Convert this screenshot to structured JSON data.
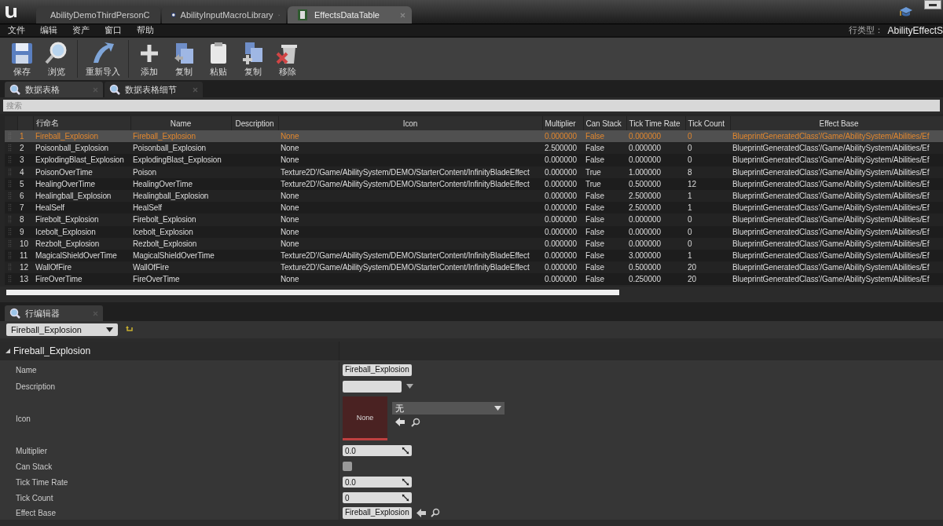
{
  "window": {
    "tabs": [
      {
        "label": "AbilityDemoThirdPersonC",
        "kind": "blueprint",
        "selected": false
      },
      {
        "label": "AbilityInputMacroLibrary",
        "kind": "macro",
        "selected": false
      },
      {
        "label": "EffectsDataTable",
        "kind": "datatable",
        "selected": true
      }
    ]
  },
  "menu": [
    "文件",
    "编辑",
    "资产",
    "窗口",
    "帮助"
  ],
  "row_type": {
    "label": "行类型：",
    "value": "AbilityEffectS"
  },
  "toolbar": [
    {
      "label": "保存",
      "kind": "save"
    },
    {
      "label": "浏览",
      "kind": "browse"
    },
    {
      "label": "重新导入",
      "kind": "reimport"
    },
    {
      "label": "添加",
      "kind": "add"
    },
    {
      "label": "复制",
      "kind": "copy"
    },
    {
      "label": "粘贴",
      "kind": "paste"
    },
    {
      "label": "复制",
      "kind": "duplicate"
    },
    {
      "label": "移除",
      "kind": "remove"
    }
  ],
  "panel_tabs": [
    {
      "label": "数据表格",
      "selected": true
    },
    {
      "label": "数据表格细节",
      "selected": false
    }
  ],
  "search": {
    "placeholder": "搜索"
  },
  "table": {
    "columns": [
      "",
      "行命名",
      "Name",
      "Description",
      "Icon",
      "Multiplier",
      "Can Stack",
      "Tick Time Rate",
      "Tick Count",
      "Effect Base"
    ],
    "rows": [
      {
        "selected": true,
        "cells": [
          "1",
          "Fireball_Explosion",
          "Fireball_Explosion",
          "",
          "None",
          "0.000000",
          "False",
          "0.000000",
          "0",
          "BlueprintGeneratedClass'/Game/AbilitySystem/Abilities/Ef"
        ]
      },
      {
        "selected": false,
        "cells": [
          "2",
          "Poisonball_Explosion",
          "Poisonball_Explosion",
          "",
          "None",
          "2.500000",
          "False",
          "0.000000",
          "0",
          "BlueprintGeneratedClass'/Game/AbilitySystem/Abilities/Ef"
        ]
      },
      {
        "selected": false,
        "cells": [
          "3",
          "ExplodingBlast_Explosion",
          "ExplodingBlast_Explosion",
          "",
          "None",
          "0.000000",
          "False",
          "0.000000",
          "0",
          "BlueprintGeneratedClass'/Game/AbilitySystem/Abilities/Ef"
        ]
      },
      {
        "selected": false,
        "cells": [
          "4",
          "PoisonOverTime",
          "Poison",
          "",
          "Texture2D'/Game/AbilitySystem/DEMO/StarterContent/InfinityBladeEffect",
          "0.000000",
          "True",
          "1.000000",
          "8",
          "BlueprintGeneratedClass'/Game/AbilitySystem/Abilities/Ef"
        ]
      },
      {
        "selected": false,
        "cells": [
          "5",
          "HealingOverTime",
          "HealingOverTime",
          "",
          "Texture2D'/Game/AbilitySystem/DEMO/StarterContent/InfinityBladeEffect",
          "0.000000",
          "True",
          "0.500000",
          "12",
          "BlueprintGeneratedClass'/Game/AbilitySystem/Abilities/Ef"
        ]
      },
      {
        "selected": false,
        "cells": [
          "6",
          "Healingball_Explosion",
          "Healingball_Explosion",
          "",
          "None",
          "0.000000",
          "False",
          "2.500000",
          "1",
          "BlueprintGeneratedClass'/Game/AbilitySystem/Abilities/Ef"
        ]
      },
      {
        "selected": false,
        "cells": [
          "7",
          "HealSelf",
          "HealSelf",
          "",
          "None",
          "0.000000",
          "False",
          "2.500000",
          "1",
          "BlueprintGeneratedClass'/Game/AbilitySystem/Abilities/Ef"
        ]
      },
      {
        "selected": false,
        "cells": [
          "8",
          "Firebolt_Explosion",
          "Firebolt_Explosion",
          "",
          "None",
          "0.000000",
          "False",
          "0.000000",
          "0",
          "BlueprintGeneratedClass'/Game/AbilitySystem/Abilities/Ef"
        ]
      },
      {
        "selected": false,
        "cells": [
          "9",
          "Icebolt_Explosion",
          "Icebolt_Explosion",
          "",
          "None",
          "0.000000",
          "False",
          "0.000000",
          "0",
          "BlueprintGeneratedClass'/Game/AbilitySystem/Abilities/Ef"
        ]
      },
      {
        "selected": false,
        "cells": [
          "10",
          "Rezbolt_Explosion",
          "Rezbolt_Explosion",
          "",
          "None",
          "0.000000",
          "False",
          "0.000000",
          "0",
          "BlueprintGeneratedClass'/Game/AbilitySystem/Abilities/Ef"
        ]
      },
      {
        "selected": false,
        "cells": [
          "11",
          "MagicalShieldOverTime",
          "MagicalShieldOverTime",
          "",
          "Texture2D'/Game/AbilitySystem/DEMO/StarterContent/InfinityBladeEffect",
          "0.000000",
          "False",
          "3.000000",
          "1",
          "BlueprintGeneratedClass'/Game/AbilitySystem/Abilities/Ef"
        ]
      },
      {
        "selected": false,
        "cells": [
          "12",
          "WallOfFire",
          "WallOfFire",
          "",
          "Texture2D'/Game/AbilitySystem/DEMO/StarterContent/InfinityBladeEffect",
          "0.000000",
          "False",
          "0.500000",
          "20",
          "BlueprintGeneratedClass'/Game/AbilitySystem/Abilities/Ef"
        ]
      },
      {
        "selected": false,
        "cells": [
          "13",
          "FireOverTime",
          "FireOverTime",
          "",
          "None",
          "0.000000",
          "False",
          "0.250000",
          "20",
          "BlueprintGeneratedClass'/Game/AbilitySystem/Abilities/Ef"
        ]
      }
    ]
  },
  "row_editor": {
    "tab": "行编辑器",
    "row_picker": "Fireball_Explosion",
    "section": "Fireball_Explosion",
    "expanded": true,
    "properties": [
      {
        "kind": "text",
        "label": "Name",
        "value": "Fireball_Explosion"
      },
      {
        "kind": "combo",
        "label": "Description"
      },
      {
        "kind": "texture",
        "label": "Icon",
        "thumbnail": "None",
        "value": "无"
      },
      {
        "kind": "number",
        "label": "Multiplier",
        "value": "0.0"
      },
      {
        "kind": "checkbox",
        "label": "Can Stack",
        "checked": false
      },
      {
        "kind": "number",
        "label": "Tick Time Rate",
        "value": "0.0"
      },
      {
        "kind": "number",
        "label": "Tick Count",
        "value": "0"
      },
      {
        "kind": "asset",
        "label": "Effect Base",
        "value": "Fireball_Explosion"
      }
    ]
  }
}
